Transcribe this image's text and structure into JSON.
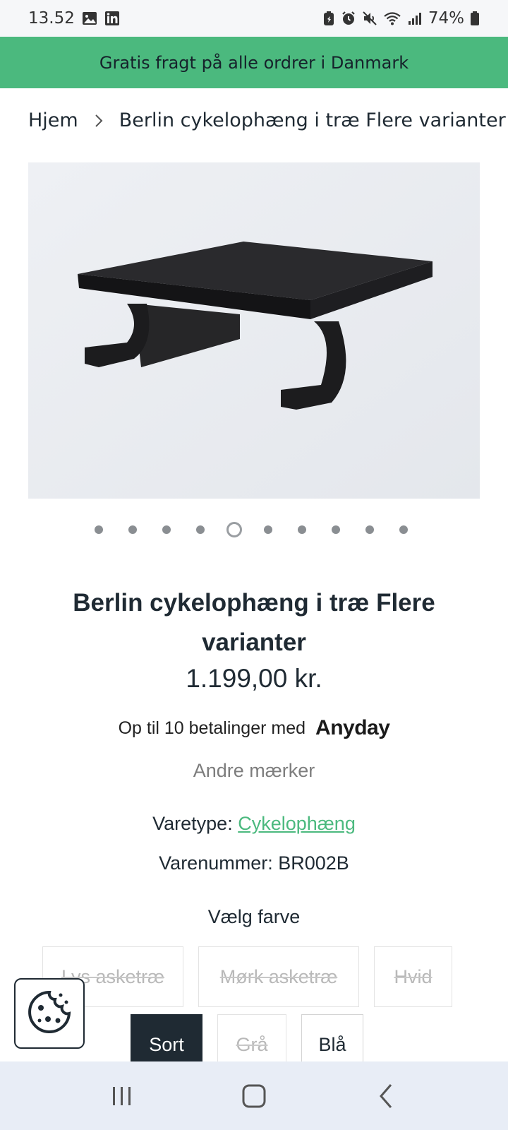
{
  "status_bar": {
    "time": "13.52",
    "battery": "74%",
    "left_icons": [
      "gallery-icon",
      "linkedin-icon"
    ],
    "right_icons": [
      "battery-saver-icon",
      "alarm-icon",
      "mute-icon",
      "wifi-icon",
      "signal-icon",
      "battery-icon"
    ]
  },
  "promo_banner": {
    "text": "Gratis fragt på alle ordrer i Danmark"
  },
  "breadcrumb": {
    "home": "Hjem",
    "current": "Berlin cykelophæng i træ Flere varianter"
  },
  "gallery": {
    "total_images": 10,
    "active_index": 4
  },
  "product": {
    "title": "Berlin cykelophæng i træ Flere varianter",
    "price": "1.199,00 kr.",
    "installments_text": "Op til 10 betalinger med",
    "installments_provider": "Anyday",
    "other_brands_link": "Andre mærker",
    "type_label": "Varetype:",
    "type_value": "Cykelophæng",
    "sku_label": "Varenummer:",
    "sku_value": "BR002B"
  },
  "color_picker": {
    "label": "Vælg farve",
    "options": [
      {
        "label": "Lys asketræ",
        "state": "unavailable"
      },
      {
        "label": "Mørk asketræ",
        "state": "unavailable"
      },
      {
        "label": "Hvid",
        "state": "unavailable"
      },
      {
        "label": "Sort",
        "state": "selected"
      },
      {
        "label": "Grå",
        "state": "unavailable"
      },
      {
        "label": "Blå",
        "state": "available"
      }
    ]
  },
  "cookie_button": {
    "icon": "cookie-icon"
  },
  "nav_bar": {
    "icons": [
      "recent-apps-icon",
      "home-icon",
      "back-icon"
    ]
  },
  "colors": {
    "accent": "#4bb97e",
    "dark": "#1f2a33",
    "muted": "#7d7d7d"
  }
}
